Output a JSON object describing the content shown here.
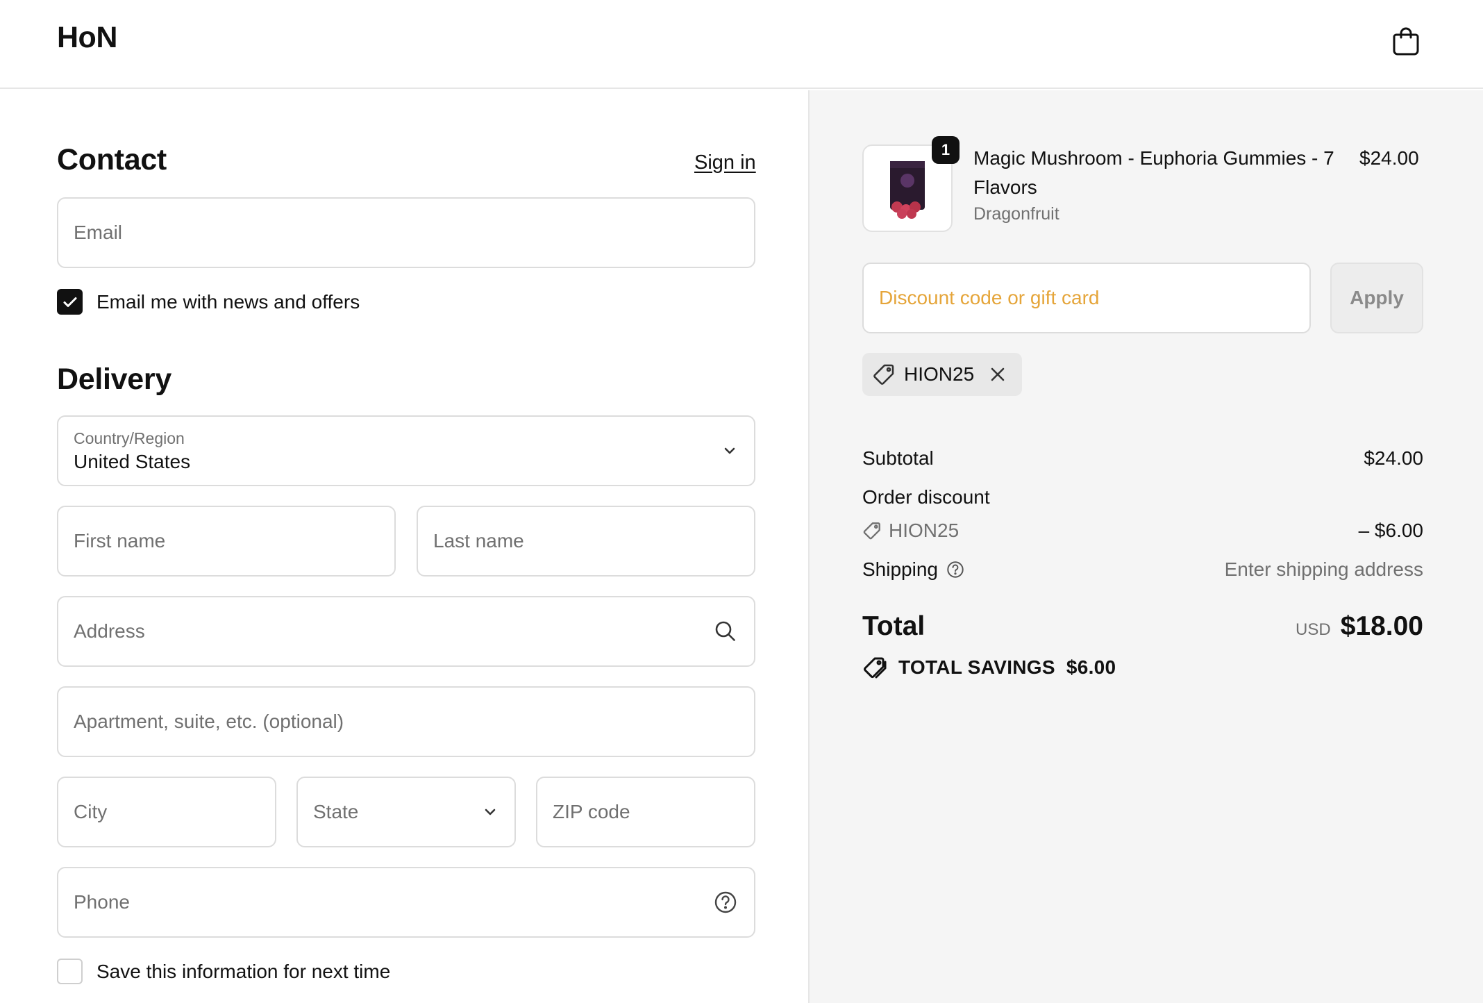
{
  "header": {
    "logo": "HoN",
    "cart_icon": "shopping-bag-icon"
  },
  "contact": {
    "title": "Contact",
    "sign_in": "Sign in",
    "email_placeholder": "Email",
    "newsletter_label": "Email me with news and offers",
    "newsletter_checked": true
  },
  "delivery": {
    "title": "Delivery",
    "country_label": "Country/Region",
    "country_value": "United States",
    "first_name_placeholder": "First name",
    "last_name_placeholder": "Last name",
    "address_placeholder": "Address",
    "apartment_placeholder": "Apartment, suite, etc. (optional)",
    "city_placeholder": "City",
    "state_placeholder": "State",
    "zip_placeholder": "ZIP code",
    "phone_placeholder": "Phone",
    "save_info_label": "Save this information for next time",
    "save_info_checked": false
  },
  "summary": {
    "product": {
      "quantity": "1",
      "name": "Magic Mushroom - Euphoria Gummies - 7 Flavors",
      "variant": "Dragonfruit",
      "price": "$24.00"
    },
    "discount_placeholder": "Discount code or gift card",
    "apply_label": "Apply",
    "applied_code": "HION25",
    "subtotal_label": "Subtotal",
    "subtotal_value": "$24.00",
    "order_discount_label": "Order discount",
    "discount_code": "HION25",
    "discount_value": "– $6.00",
    "shipping_label": "Shipping",
    "shipping_value": "Enter shipping address",
    "total_label": "Total",
    "total_currency": "USD",
    "total_value": "$18.00",
    "savings_label": "TOTAL SAVINGS",
    "savings_value": "$6.00"
  },
  "colors": {
    "discount_placeholder": "#e5a53a",
    "summary_background": "#f5f5f5",
    "text_primary": "#111111",
    "text_muted": "#707070"
  }
}
